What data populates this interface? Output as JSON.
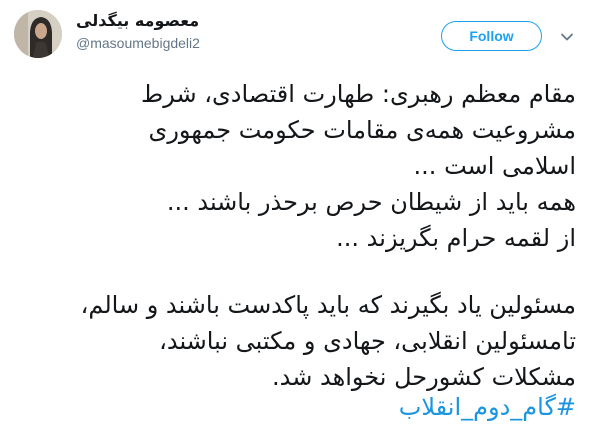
{
  "tweet": {
    "display_name": "معصومه بیگدلی",
    "handle": "@masoumebigdeli2",
    "follow_label": "Follow",
    "menu_icon": "chevron-down-icon",
    "avatar_icon": "avatar",
    "text_lines_1": [
      "مقام معظم رهبری: طهارت اقتصادی، شرط",
      "مشروعیت همه‌ی مقامات حکومت جمهوری",
      "اسلامی است ...",
      "همه باید از شیطان حرص برحذر باشند ...",
      "از لقمه حرام بگریزند ..."
    ],
    "text_lines_2": [
      "مسئولین یاد بگیرند که باید پاکدست باشند و سالم،",
      "تامسئولین انقلابی، جهادی و مکتبی نباشند،",
      "مشکلات کشورحل نخواهد شد."
    ],
    "hashtag": "#گام_دوم_انقلاب"
  },
  "colors": {
    "accent": "#1da1f2",
    "hashtag": "#1b95e0",
    "text": "#14171a",
    "secondary": "#657786"
  }
}
